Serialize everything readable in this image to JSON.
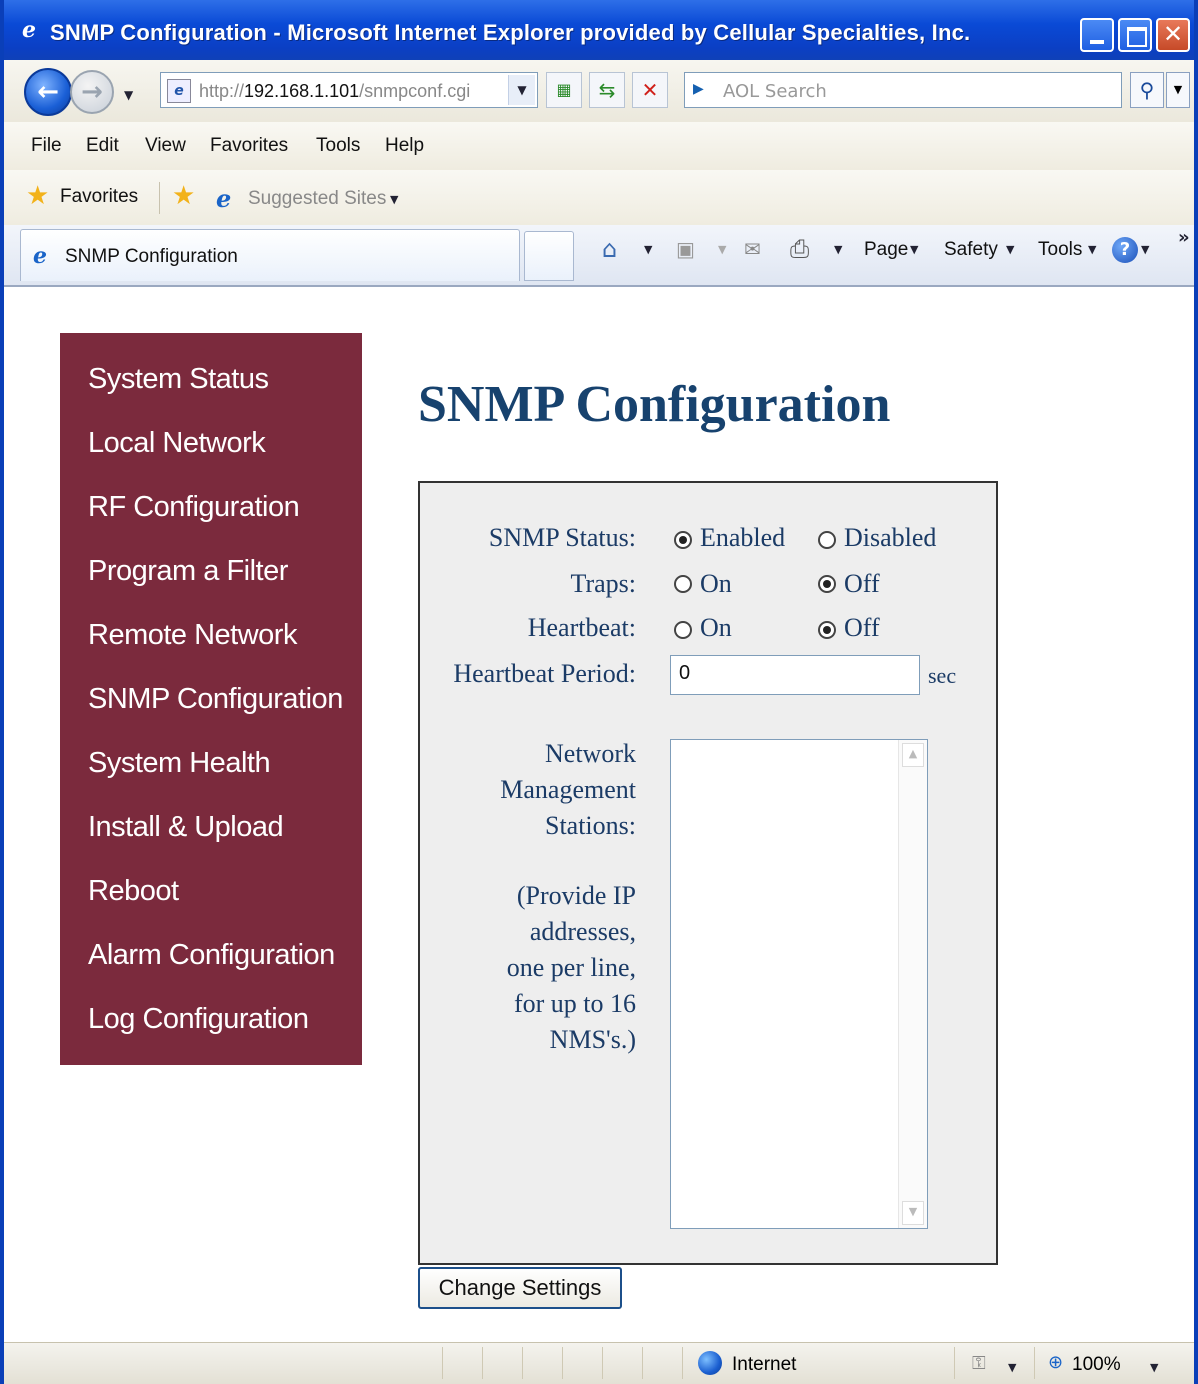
{
  "window": {
    "title": "SNMP Configuration - Microsoft Internet Explorer provided by Cellular Specialties, Inc."
  },
  "address_bar": {
    "url_prefix": "http://",
    "url_host": "192.168.1.101",
    "url_path": "/snmpconf.cgi",
    "search_placeholder": "AOL Search"
  },
  "menu": [
    "File",
    "Edit",
    "View",
    "Favorites",
    "Tools",
    "Help"
  ],
  "favorites_bar": {
    "favorites_label": "Favorites",
    "suggested_sites_label": "Suggested Sites"
  },
  "tab": {
    "title": "SNMP Configuration"
  },
  "command_bar": {
    "page": "Page",
    "safety": "Safety",
    "tools": "Tools",
    "overflow": "»"
  },
  "sidebar": {
    "items": [
      "System Status",
      "Local Network",
      "RF Configuration",
      "Program a Filter",
      "Remote Network",
      "SNMP Configuration",
      "System Health",
      "Install & Upload",
      "Reboot",
      "Alarm Configuration",
      "Log Configuration"
    ]
  },
  "page": {
    "title": "SNMP Configuration"
  },
  "form": {
    "snmp_status_label": "SNMP Status:",
    "snmp_enabled": "Enabled",
    "snmp_disabled": "Disabled",
    "snmp_status_value": "Enabled",
    "traps_label": "Traps:",
    "traps_on": "On",
    "traps_off": "Off",
    "traps_value": "Off",
    "heartbeat_label": "Heartbeat:",
    "heartbeat_on": "On",
    "heartbeat_off": "Off",
    "heartbeat_value": "Off",
    "heartbeat_period_label": "Heartbeat Period:",
    "heartbeat_period_value": "0",
    "heartbeat_period_unit": "sec",
    "nms_label": [
      "Network",
      "Management",
      "Stations:"
    ],
    "nms_hint": [
      "(Provide IP",
      "addresses,",
      "one per line,",
      "for up to 16",
      "NMS's.)"
    ],
    "nms_value": "",
    "submit_label": "Change Settings"
  },
  "status_bar": {
    "zone": "Internet",
    "zoom": "100%"
  }
}
